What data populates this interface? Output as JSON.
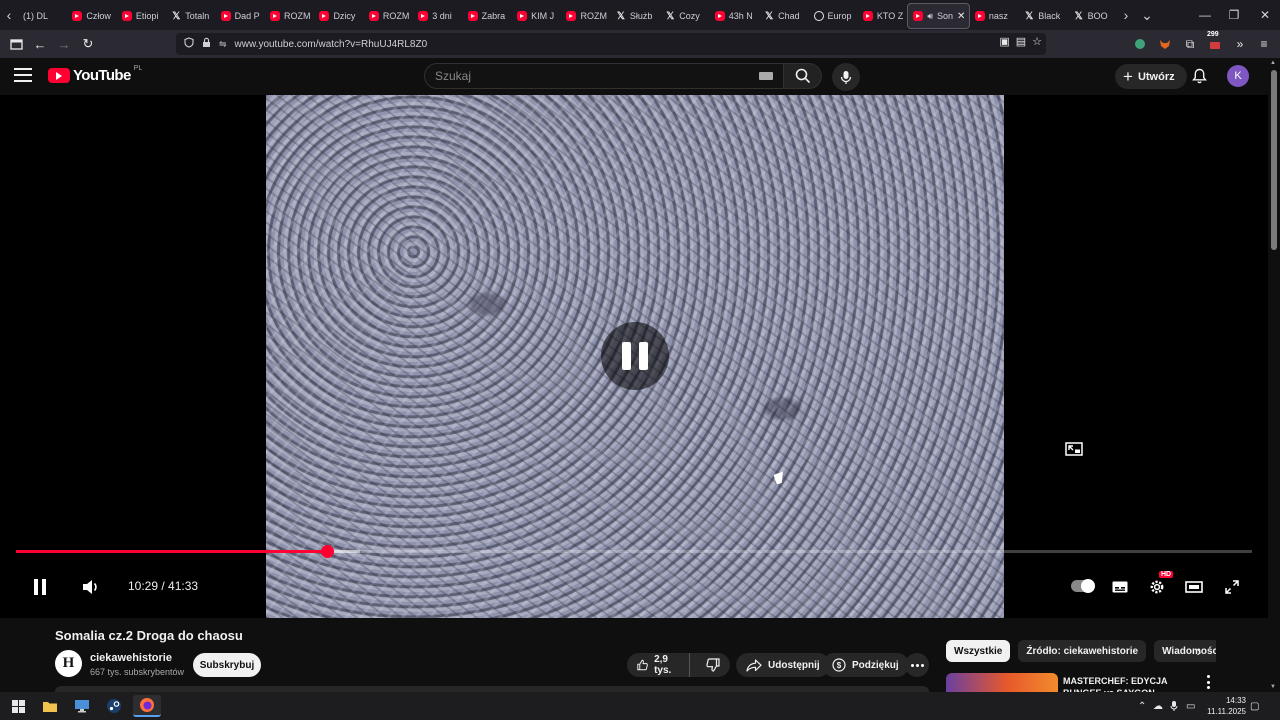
{
  "browser": {
    "tabs": [
      {
        "label": "(1) DL",
        "icon": "none",
        "active": false
      },
      {
        "label": "Człow",
        "icon": "youtube-icon",
        "active": false
      },
      {
        "label": "Etiopi",
        "icon": "youtube-icon",
        "active": false
      },
      {
        "label": "Totaln",
        "icon": "x-icon",
        "active": false
      },
      {
        "label": "Dad P",
        "icon": "youtube-icon",
        "active": false
      },
      {
        "label": "ROZM",
        "icon": "youtube-icon",
        "active": false
      },
      {
        "label": "Dzicy",
        "icon": "youtube-icon",
        "active": false
      },
      {
        "label": "ROZM",
        "icon": "youtube-icon",
        "active": false
      },
      {
        "label": "3 dni",
        "icon": "youtube-icon",
        "active": false
      },
      {
        "label": "Zabra",
        "icon": "youtube-icon",
        "active": false
      },
      {
        "label": "KIM J",
        "icon": "youtube-icon",
        "active": false
      },
      {
        "label": "ROZM",
        "icon": "youtube-icon",
        "active": false
      },
      {
        "label": "Służb",
        "icon": "x-icon",
        "active": false
      },
      {
        "label": "Cozy",
        "icon": "x-icon",
        "active": false
      },
      {
        "label": "43h N",
        "icon": "youtube-icon",
        "active": false
      },
      {
        "label": "Chad",
        "icon": "x-icon",
        "active": false
      },
      {
        "label": "Europ",
        "icon": "globe-icon",
        "active": false
      },
      {
        "label": "KTO Z",
        "icon": "youtube-icon",
        "active": false
      },
      {
        "label": "Son",
        "icon": "youtube-icon",
        "active": true
      },
      {
        "label": "nasz",
        "icon": "youtube-icon",
        "active": false
      },
      {
        "label": "Black",
        "icon": "x-icon",
        "active": false
      },
      {
        "label": "BOO",
        "icon": "x-icon",
        "active": false
      }
    ],
    "url": "www.youtube.com/watch?v=RhuUJ4RL8Z0",
    "notification_count": "299"
  },
  "youtube": {
    "logo_text": "YouTube",
    "region": "PL",
    "search_placeholder": "Szukaj",
    "create_label": "Utwórz",
    "avatar_letter": "K"
  },
  "player": {
    "current_time": "10:29",
    "duration": "41:33",
    "time_display": "10:29 / 41:33",
    "played_fraction": 0.252,
    "buffered_fraction": 0.278,
    "state": "playing",
    "quality_badge": "HD",
    "colors": {
      "progress": "#ff0033"
    }
  },
  "video": {
    "title": "Somalia cz.2 Droga do chaosu",
    "channel_name": "ciekawehistorie",
    "channel_initial": "H",
    "subscribers": "667 tys. subskrybentów",
    "subscribe_label": "Subskrybuj",
    "likes": "2,9 tys.",
    "share_label": "Udostępnij",
    "thanks_label": "Podziękuj"
  },
  "sidebar": {
    "chips": [
      "Wszystkie",
      "Źródło: ciekawehistorie",
      "Wiadomości"
    ],
    "recommendation_title": "MASTERCHEF: EDYCJA BUNGEE vs SAYGON"
  },
  "taskbar": {
    "time": "14:33",
    "date": "11.11.2025"
  }
}
